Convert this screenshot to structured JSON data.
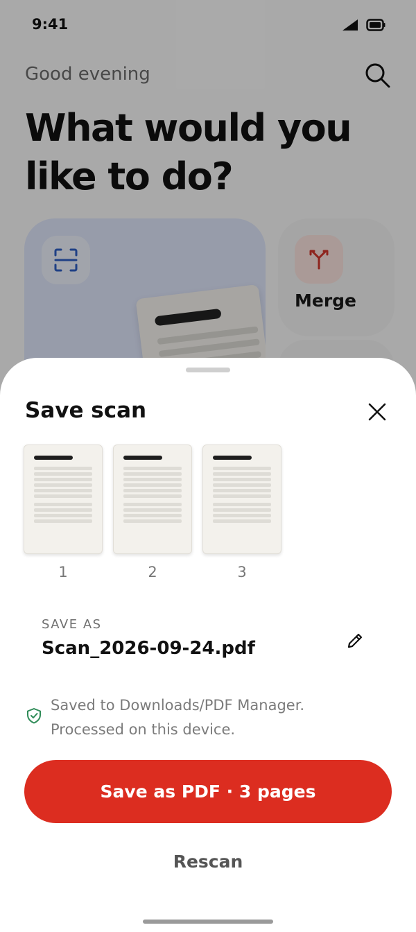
{
  "status_bar": {
    "time": "9:41",
    "icons": [
      "signal-icon",
      "battery-icon"
    ]
  },
  "home": {
    "greeting": "Good evening",
    "headline": "What would you like to do?",
    "search_icon": "search-icon",
    "cards": {
      "scan": {
        "icon": "scan-icon"
      },
      "merge": {
        "icon": "merge-icon",
        "label": "Merge"
      }
    }
  },
  "sheet": {
    "title": "Save scan",
    "close_icon": "close-icon",
    "pages": [
      {
        "number": "1"
      },
      {
        "number": "2"
      },
      {
        "number": "3"
      }
    ],
    "save_as": {
      "label": "SAVE AS",
      "filename": "Scan_2026-09-24.pdf",
      "edit_icon": "pencil-icon"
    },
    "storage_note": "Saved to Downloads/PDF Manager. Processed on this device.",
    "storage_icon": "shield-check-icon",
    "primary_button": "Save as PDF · 3 pages",
    "secondary_button": "Rescan"
  },
  "colors": {
    "accent": "#dc2d20",
    "scan_card": "#dfe6fb",
    "merge_icon_bg": "#fbe3df",
    "shield": "#2e8b57"
  }
}
